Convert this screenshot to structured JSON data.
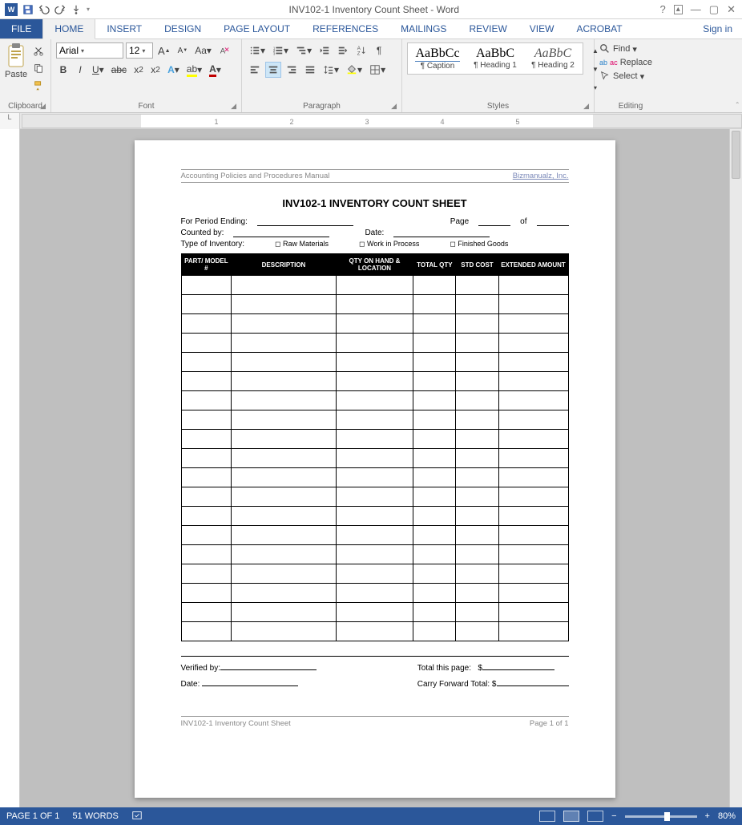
{
  "title": "INV102-1 Inventory Count Sheet - Word",
  "signin": "Sign in",
  "tabs": [
    "FILE",
    "HOME",
    "INSERT",
    "DESIGN",
    "PAGE LAYOUT",
    "REFERENCES",
    "MAILINGS",
    "REVIEW",
    "VIEW",
    "ACROBAT"
  ],
  "active_tab": 1,
  "ribbon": {
    "groups": {
      "clipboard": "Clipboard",
      "font": "Font",
      "paragraph": "Paragraph",
      "styles": "Styles",
      "editing": "Editing"
    },
    "paste": "Paste",
    "font_name": "Arial",
    "font_size": "12",
    "styles": [
      {
        "preview": "AaBbCc",
        "name": "¶ Caption"
      },
      {
        "preview": "AaBbC",
        "name": "¶ Heading 1"
      },
      {
        "preview": "AaBbC",
        "name": "¶ Heading 2"
      }
    ],
    "editing": {
      "find": "Find",
      "replace": "Replace",
      "select": "Select"
    }
  },
  "document": {
    "header_left": "Accounting Policies and Procedures Manual",
    "header_right": "Bizmanualz, Inc.",
    "title": "INV102-1 INVENTORY COUNT SHEET",
    "fields": {
      "period": "For Period Ending:",
      "page": "Page",
      "of": "of",
      "counted_by": "Counted by:",
      "date": "Date:",
      "type": "Type of Inventory:",
      "type_opts": [
        "Raw Materials",
        "Work in Process",
        "Finished Goods"
      ]
    },
    "columns": [
      "PART/ MODEL #",
      "DESCRIPTION",
      "QTY ON HAND & LOCATION",
      "TOTAL QTY",
      "STD COST",
      "EXTENDED AMOUNT"
    ],
    "row_count": 19,
    "footer": {
      "verified": "Verified by:",
      "date": "Date:",
      "total": "Total this page:",
      "carry": "Carry Forward Total: $",
      "dollar": "$"
    },
    "pgfooter_left": "INV102-1 Inventory Count Sheet",
    "pgfooter_right": "Page 1 of 1"
  },
  "status": {
    "page": "PAGE 1 OF 1",
    "words": "51 WORDS",
    "zoom": "80%"
  }
}
